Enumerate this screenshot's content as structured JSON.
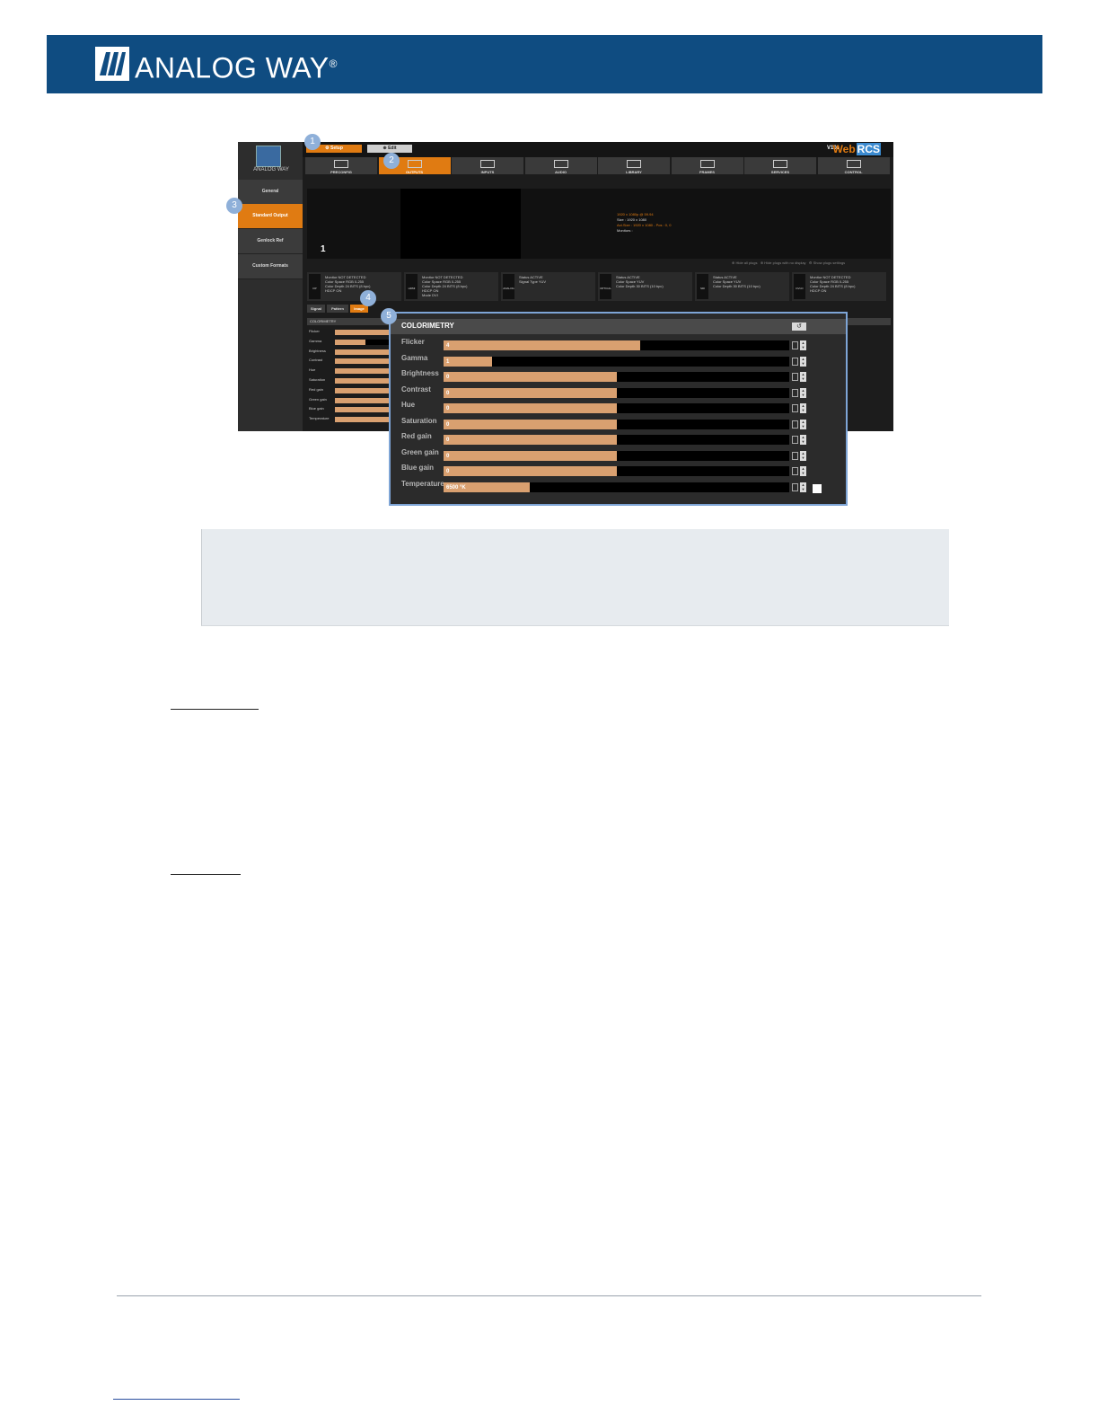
{
  "header": {
    "brand": "ANALOG WAY",
    "registered": "®",
    "background_color": "#0f4c81"
  },
  "app": {
    "logo_text": "ANALOG WAY",
    "mode_buttons": [
      {
        "label": "Setup",
        "active": true
      },
      {
        "label": "Edit",
        "active": false
      }
    ],
    "version_label": "V101",
    "web_logo": {
      "web": "Web",
      "rcs": "RCS"
    },
    "nav": [
      {
        "label": "PRECONFIG",
        "active": false
      },
      {
        "label": "OUTPUTS",
        "active": true
      },
      {
        "label": "INPUTS",
        "active": false
      },
      {
        "label": "AUDIO",
        "active": false
      },
      {
        "label": "LIBRARY",
        "active": false
      },
      {
        "label": "FRAMES",
        "active": false
      },
      {
        "label": "SERVICES",
        "active": false
      },
      {
        "label": "CONTROL",
        "active": false
      }
    ],
    "sidebar": [
      {
        "label": "General",
        "active": false
      },
      {
        "label": "Standard Output",
        "active": true
      },
      {
        "label": "Genlock Ref",
        "active": false
      },
      {
        "label": "Custom Formats",
        "active": false
      }
    ],
    "preview": {
      "number": "1",
      "info_lines": [
        "1920 x 1080p @ 59.94",
        "Size : 1920 x 1080",
        "Act.Size : 1920 x 1080 - Pos : 0, 0",
        "Monitors :"
      ]
    },
    "plug_actions": [
      "Hide all plugs",
      "Hide plugs with no display",
      "Show plugs settings"
    ],
    "connectors": [
      {
        "name": "DP",
        "lines": [
          "Monitor   NOT DETECTED",
          "Color Space   RGB 0-255",
          "Color Depth   24 BITS (8 bpc)",
          "HDCP   ON"
        ]
      },
      {
        "name": "HDMI",
        "lines": [
          "Monitor   NOT DETECTED",
          "Color Space   RGB 0-255",
          "Color Depth   24 BITS (8 bpc)",
          "HDCP   ON",
          "Mode   DVI"
        ]
      },
      {
        "name": "ANALOG",
        "lines": [
          "Status   ACTIVE",
          "Signal Type   YUV"
        ]
      },
      {
        "name": "OPTICAL",
        "lines": [
          "Status   ACTIVE",
          "Color Space   YUV",
          "Color Depth   30 BITS (10 bpc)"
        ]
      },
      {
        "name": "SDI",
        "lines": [
          "Status   ACTIVE",
          "Color Space   YUV",
          "Color Depth   30 BITS (10 bpc)"
        ]
      },
      {
        "name": "DVI-D",
        "lines": [
          "Monitor   NOT DETECTED",
          "Color Space   RGB 0-255",
          "Color Depth   24 BITS (8 bpc)",
          "HDCP   ON"
        ]
      }
    ],
    "tabs": [
      {
        "label": "Signal",
        "active": false
      },
      {
        "label": "Pattern",
        "active": false
      },
      {
        "label": "Image",
        "active": true
      }
    ],
    "colorimetry_title": "COLORIMETRY"
  },
  "zoom": {
    "title": "COLORIMETRY",
    "reset_icon": "↺",
    "rows": [
      {
        "label": "Flicker",
        "value": "4",
        "fill": 0.57
      },
      {
        "label": "Gamma",
        "value": "1",
        "fill": 0.14
      },
      {
        "label": "Brightness",
        "value": "0",
        "fill": 0.5
      },
      {
        "label": "Contrast",
        "value": "0",
        "fill": 0.5
      },
      {
        "label": "Hue",
        "value": "0",
        "fill": 0.5
      },
      {
        "label": "Saturation",
        "value": "0",
        "fill": 0.5
      },
      {
        "label": "Red gain",
        "value": "0",
        "fill": 0.5
      },
      {
        "label": "Green gain",
        "value": "0",
        "fill": 0.5
      },
      {
        "label": "Blue gain",
        "value": "0",
        "fill": 0.5
      },
      {
        "label": "Temperature",
        "value": "6500 °K",
        "fill": 0.25
      }
    ],
    "accent_color": "#d9a070"
  },
  "markers": [
    "1",
    "2",
    "3",
    "4",
    "5"
  ]
}
